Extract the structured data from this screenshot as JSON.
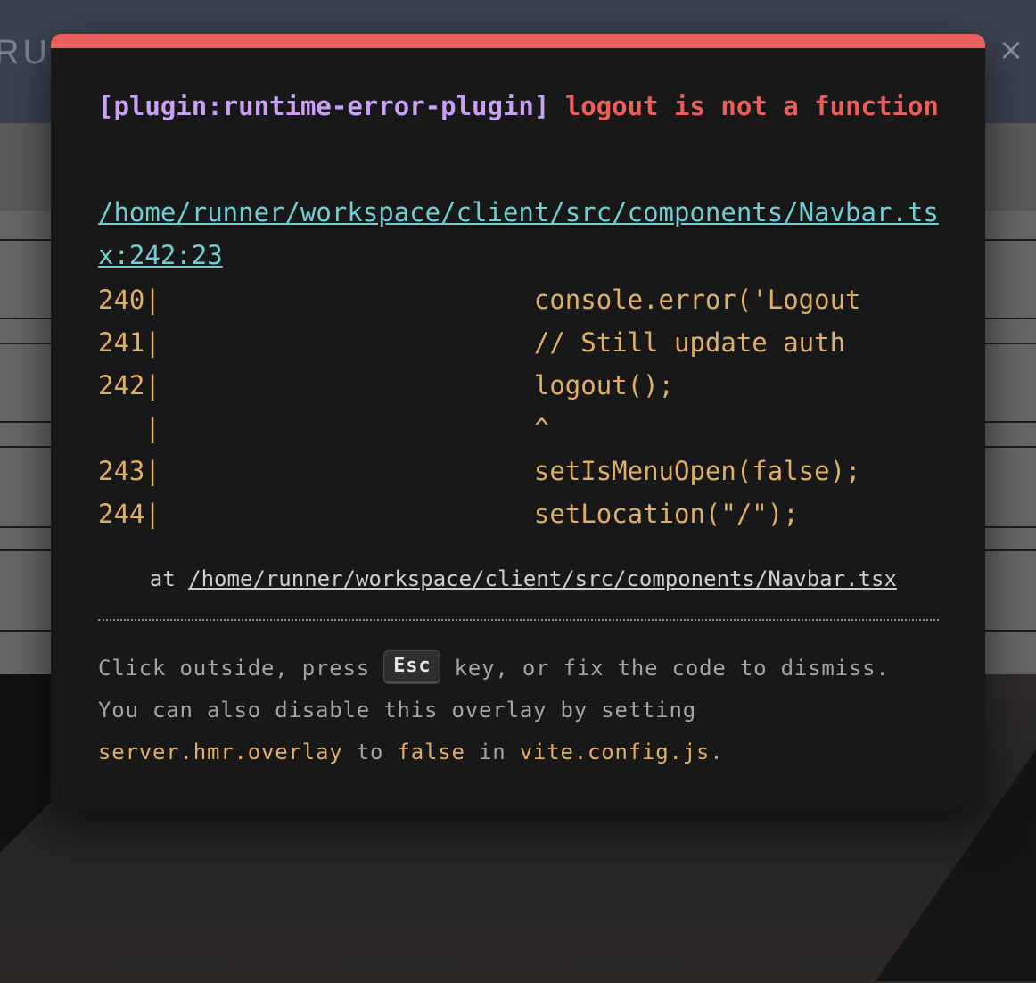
{
  "background": {
    "brand_partial": "RUS"
  },
  "overlay": {
    "close_icon": "×",
    "plugin": "[plugin:runtime-error-plugin]",
    "message": "logout is not a function",
    "file": "/home/runner/workspace/client/src/components/Navbar.tsx:242:23",
    "frame": [
      "240|                        console.error('Logout",
      "241|                        // Still update auth",
      "242|                        logout();",
      "   |                        ^",
      "243|                        setIsMenuOpen(false);",
      "244|                        setLocation(\"/\");"
    ],
    "stack": {
      "prefix": "    at ",
      "path": "/home/runner/workspace/client/src/components/Navbar.tsx"
    },
    "tip": {
      "part1": "Click outside, press ",
      "key": "Esc",
      "part2": " key, or fix the code to dismiss.",
      "part3": "You can also disable this overlay by setting ",
      "config_key": "server.hmr.overlay",
      "part4": " to ",
      "value": "false",
      "part5": " in ",
      "config_file": "vite.config.js",
      "part6": "."
    }
  },
  "colors": {
    "accent_red": "#ed5e5a",
    "plugin_purple": "#c9a0f5",
    "link_cyan": "#6ed0d6",
    "code_yellow": "#e0b062",
    "overlay_bg": "#181818"
  }
}
